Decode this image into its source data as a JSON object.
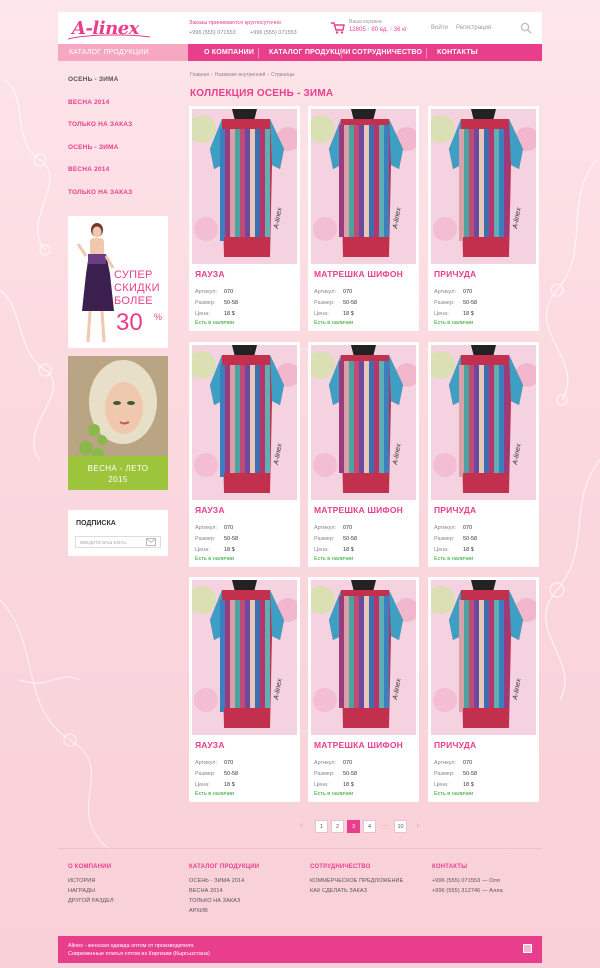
{
  "header": {
    "logo": "A-linex",
    "order_note": "Заказы принимаются круглосуточно",
    "phone1": "+996 (555) 071553",
    "phone2": "+996 (555) 071553",
    "cart_label": "Ваша корзина",
    "cart_sum": "12805",
    "cart_qty": "80 ед.",
    "cart_weight": "36 кг",
    "login": "Войти",
    "register": "Регистрация"
  },
  "nav": {
    "catalog": "КАТАЛОГ ПРОДУКЦИИ",
    "items": [
      "О КОМПАНИИ",
      "КАТАЛОГ ПРОДУКЦИИ",
      "СОТРУДНИЧЕСТВО",
      "КОНТАКТЫ"
    ]
  },
  "sidebar": {
    "items": [
      "ОСЕНЬ - ЗИМА",
      "ВЕСНА 2014",
      "ТОЛЬКО НА ЗАКАЗ",
      "ОСЕНЬ - ЗИМА",
      "ВЕСНА 2014",
      "ТОЛЬКО НА ЗАКАЗ"
    ],
    "banner1": {
      "line1": "СУПЕР",
      "line2": "СКИДКИ",
      "line3": "БОЛЕЕ",
      "percent": "30",
      "pct_sign": "%"
    },
    "banner2": {
      "line1": "ВЕСНА - ЛЕТО",
      "line2": "2015"
    },
    "subscribe": {
      "title": "ПОДПИСКА",
      "placeholder": "ВВЕДИТЕ ВАШ EMAIL"
    }
  },
  "content": {
    "breadcrumbs": [
      "Главная",
      "Название внутренней",
      "Страницы"
    ],
    "title": "КОЛЛЕКЦИЯ ОСЕНЬ - ЗИМА",
    "labels": {
      "article": "Артикул:",
      "size": "Размер:",
      "price": "Цена:"
    },
    "products": [
      {
        "name": "ЯАУЗА",
        "article": "070",
        "size": "50-58",
        "price": "18 $",
        "stock": "Есть  в наличии"
      },
      {
        "name": "МАТРЕШКА ШИФОН",
        "article": "070",
        "size": "50-58",
        "price": "18 $",
        "stock": "Есть  в наличии"
      },
      {
        "name": "ПРИЧУДА",
        "article": "070",
        "size": "50-58",
        "price": "18 $",
        "stock": "Есть  в наличии"
      },
      {
        "name": "ЯАУЗА",
        "article": "070",
        "size": "50-58",
        "price": "18 $",
        "stock": "Есть  в наличии"
      },
      {
        "name": "МАТРЕШКА ШИФОН",
        "article": "070",
        "size": "50-58",
        "price": "18 $",
        "stock": "Есть  в наличии"
      },
      {
        "name": "ПРИЧУДА",
        "article": "070",
        "size": "50-58",
        "price": "18 $",
        "stock": "Есть  в наличии"
      },
      {
        "name": "ЯАУЗА",
        "article": "070",
        "size": "50-58",
        "price": "18 $",
        "stock": "Есть  в наличии"
      },
      {
        "name": "МАТРЕШКА ШИФОН",
        "article": "070",
        "size": "50-58",
        "price": "18 $",
        "stock": "Есть  в наличии"
      },
      {
        "name": "ПРИЧУДА",
        "article": "070",
        "size": "50-58",
        "price": "18 $",
        "stock": "Есть  в наличии"
      }
    ]
  },
  "pagination": {
    "pages": [
      "1",
      "2",
      "3",
      "4",
      "10"
    ],
    "current": "3",
    "dots": "..."
  },
  "footer": {
    "col1": {
      "title": "О КОМПАНИИ",
      "links": [
        "ИСТОРИЯ",
        "НАГРАДЫ",
        "ДРУГОЙ РАЗДЕЛ"
      ]
    },
    "col2": {
      "title": "КАТАЛОГ ПРОДУКЦИИ",
      "links": [
        "ОСЕНЬ - ЗИМА 2014",
        "ВЕСНА 2014",
        "ТОЛЬКО НА ЗАКАЗ",
        "АРХИВ"
      ]
    },
    "col3": {
      "title": "СОТРУДНИЧЕСТВО",
      "links": [
        "КОММЕРЧЕСКОЕ ПРЕДЛОЖЕНИЕ",
        "КАК СДЕЛАТЬ ЗАКАЗ"
      ]
    },
    "col4": {
      "title": "КОНТАКТЫ",
      "links": [
        "+996 (555) 071553 — Оля",
        "+996 (555) 312746 — Алла"
      ]
    },
    "bottom_line1": "Alinex - женская одежда оптом от производителя.",
    "bottom_line2": "Современные платья оптом из Киргизии (Кыргызстана)"
  },
  "colors": {
    "accent": "#e83e8c",
    "accent_light": "#f6a8c3",
    "background": "#fbd9df",
    "in_stock": "#2aa32a"
  }
}
